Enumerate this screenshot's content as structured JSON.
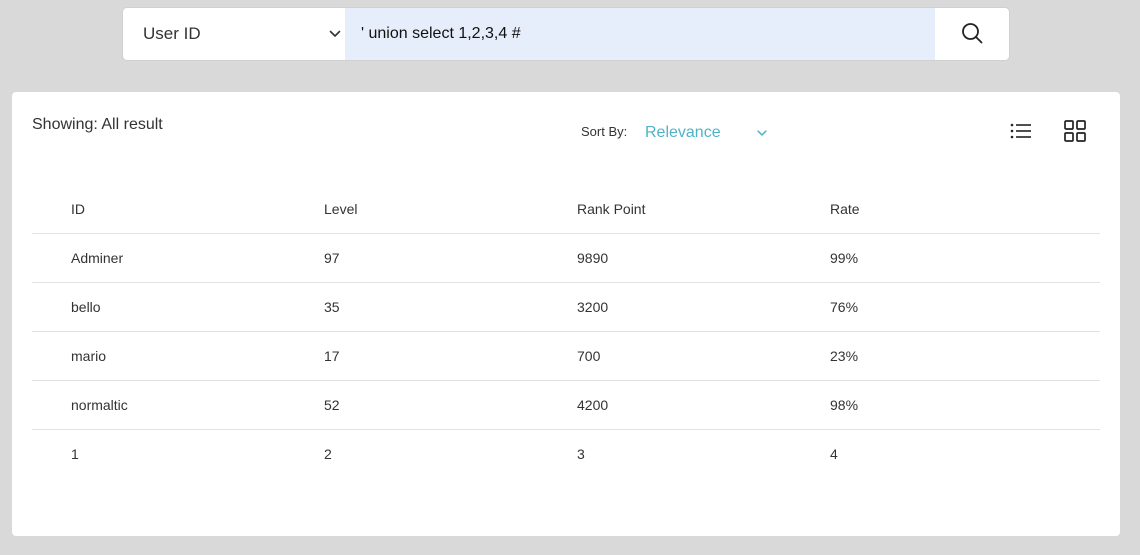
{
  "search": {
    "filter_value": "User ID",
    "query": "' union select 1,2,3,4 #"
  },
  "results": {
    "showing_text": "Showing: All result",
    "sort_label": "Sort By:",
    "sort_value": "Relevance"
  },
  "table": {
    "headers": [
      "ID",
      "Level",
      "Rank Point",
      "Rate"
    ],
    "rows": [
      [
        "Adminer",
        "97",
        "9890",
        "99%"
      ],
      [
        "bello",
        "35",
        "3200",
        "76%"
      ],
      [
        "mario",
        "17",
        "700",
        "23%"
      ],
      [
        "normaltic",
        "52",
        "4200",
        "98%"
      ],
      [
        "1",
        "2",
        "3",
        "4"
      ]
    ]
  },
  "icons": {
    "search": "search-icon",
    "filter_dropdown": "chevron-down-icon",
    "sort_dropdown": "chevron-down-icon",
    "list_view": "list-view-icon",
    "grid_view": "grid-view-icon"
  },
  "colors": {
    "page_background": "#d9d9d9",
    "search_input_background": "#e7eefb",
    "sort_value_accent": "#4fb3c8",
    "row_divider": "#e2e2e2"
  }
}
